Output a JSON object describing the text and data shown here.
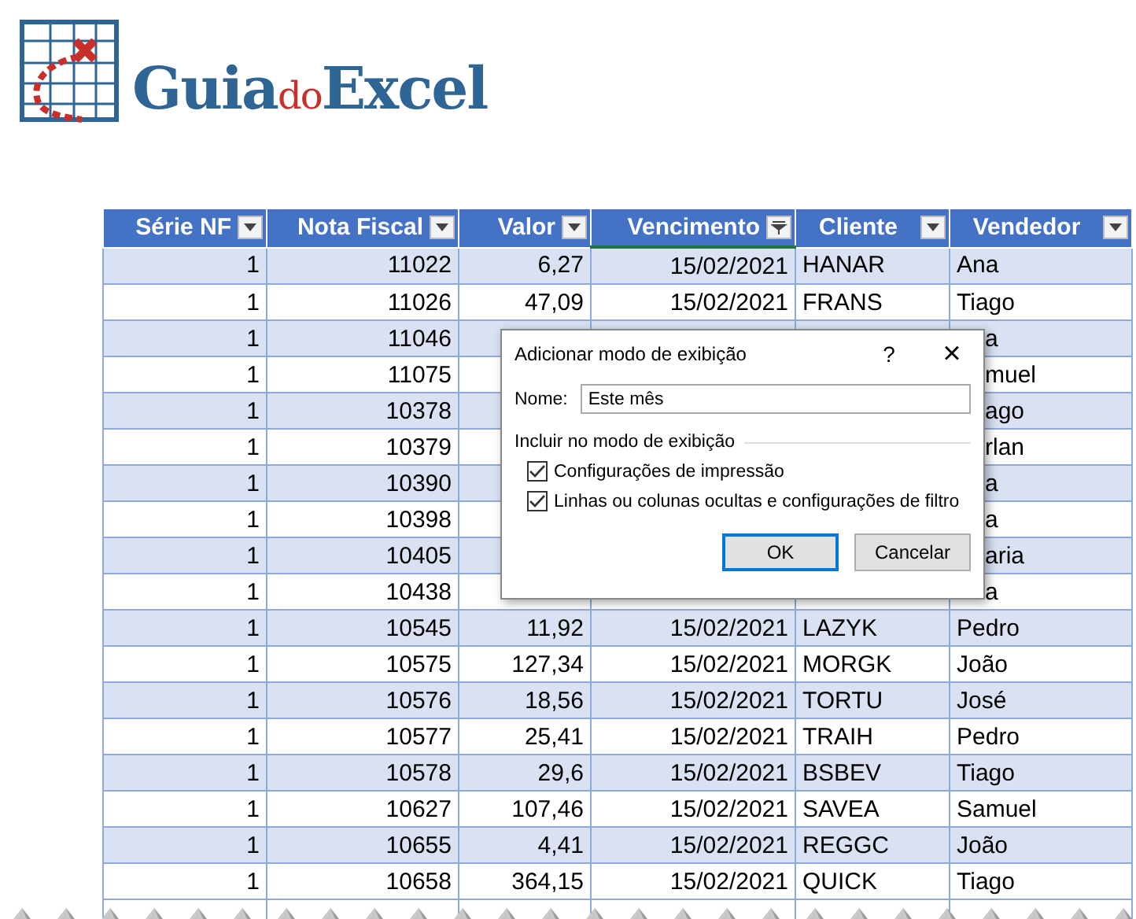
{
  "logo": [
    {
      "text": "Guia",
      "color": "#2e6595"
    },
    {
      "text": "do",
      "color": "#c9302c"
    },
    {
      "text": "Excel",
      "color": "#2e6595"
    }
  ],
  "table": {
    "columns": [
      {
        "label": "Série NF",
        "kind": "number",
        "filtered": false
      },
      {
        "label": "Nota Fiscal",
        "kind": "number",
        "filtered": false
      },
      {
        "label": "Valor",
        "kind": "number",
        "filtered": false
      },
      {
        "label": "Vencimento",
        "kind": "number",
        "filtered": true
      },
      {
        "label": "Cliente",
        "kind": "text",
        "filtered": false
      },
      {
        "label": "Vendedor",
        "kind": "text",
        "filtered": false
      }
    ],
    "rows": [
      {
        "serie_nf": "1",
        "nota_fiscal": "11022",
        "valor": "6,27",
        "vencimento": "15/02/2021",
        "cliente": "HANAR",
        "vendedor": "Ana"
      },
      {
        "serie_nf": "1",
        "nota_fiscal": "11026",
        "valor": "47,09",
        "vencimento": "15/02/2021",
        "cliente": "FRANS",
        "vendedor": "Tiago"
      },
      {
        "serie_nf": "1",
        "nota_fiscal": "11046",
        "vendedor": "a"
      },
      {
        "serie_nf": "1",
        "nota_fiscal": "11075",
        "vendedor": "muel"
      },
      {
        "serie_nf": "1",
        "nota_fiscal": "10378",
        "vendedor": "ago"
      },
      {
        "serie_nf": "1",
        "nota_fiscal": "10379",
        "vendedor": "rlan"
      },
      {
        "serie_nf": "1",
        "nota_fiscal": "10390",
        "vendedor": "a"
      },
      {
        "serie_nf": "1",
        "nota_fiscal": "10398",
        "vendedor": "a"
      },
      {
        "serie_nf": "1",
        "nota_fiscal": "10405",
        "vendedor": "aria"
      },
      {
        "serie_nf": "1",
        "nota_fiscal": "10438",
        "vendedor": "a"
      },
      {
        "serie_nf": "1",
        "nota_fiscal": "10545",
        "valor": "11,92",
        "vencimento": "15/02/2021",
        "cliente": "LAZYK",
        "vendedor": "Pedro"
      },
      {
        "serie_nf": "1",
        "nota_fiscal": "10575",
        "valor": "127,34",
        "vencimento": "15/02/2021",
        "cliente": "MORGK",
        "vendedor": "João"
      },
      {
        "serie_nf": "1",
        "nota_fiscal": "10576",
        "valor": "18,56",
        "vencimento": "15/02/2021",
        "cliente": "TORTU",
        "vendedor": "José"
      },
      {
        "serie_nf": "1",
        "nota_fiscal": "10577",
        "valor": "25,41",
        "vencimento": "15/02/2021",
        "cliente": "TRAIH",
        "vendedor": "Pedro"
      },
      {
        "serie_nf": "1",
        "nota_fiscal": "10578",
        "valor": "29,6",
        "vencimento": "15/02/2021",
        "cliente": "BSBEV",
        "vendedor": "Tiago"
      },
      {
        "serie_nf": "1",
        "nota_fiscal": "10627",
        "valor": "107,46",
        "vencimento": "15/02/2021",
        "cliente": "SAVEA",
        "vendedor": "Samuel"
      },
      {
        "serie_nf": "1",
        "nota_fiscal": "10655",
        "valor": "4,41",
        "vencimento": "15/02/2021",
        "cliente": "REGGC",
        "vendedor": "João"
      },
      {
        "serie_nf": "1",
        "nota_fiscal": "10658",
        "valor": "364,15",
        "vencimento": "15/02/2021",
        "cliente": "QUICK",
        "vendedor": "Tiago"
      }
    ]
  },
  "dialog": {
    "title": "Adicionar modo de exibição",
    "help": "?",
    "close": "×",
    "name_label": "Nome:",
    "name_value": "Este mês",
    "group_label": "Incluir no modo de exibição",
    "options": [
      {
        "label": "Configurações de impressão",
        "checked": true
      },
      {
        "label": "Linhas ou colunas ocultas e configurações de filtro",
        "checked": true
      }
    ],
    "buttons": [
      {
        "label": "OK",
        "default": true
      },
      {
        "label": "Cancelar",
        "default": false
      }
    ]
  }
}
